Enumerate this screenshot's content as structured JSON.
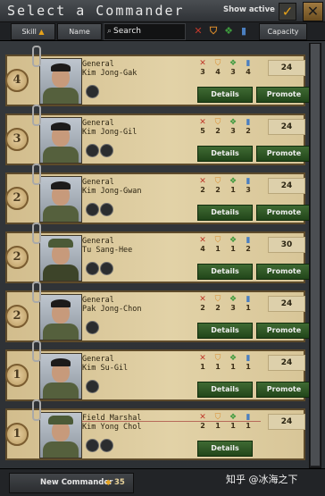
{
  "header": {
    "title": "Select a Commander",
    "show_active_label": "Show active",
    "checkmark": "✓",
    "close_icon_text": "✕"
  },
  "filter_bar": {
    "skill_label": "Skill",
    "name_label": "Name",
    "search_placeholder": "Search",
    "capacity_label": "Capacity"
  },
  "commanders": [
    {
      "level": "4",
      "rank": "General",
      "name": "Kim Jong-Gak",
      "stats": [
        "3",
        "4",
        "3",
        "4"
      ],
      "capacity": "24",
      "details_label": "Details",
      "promote_label": "Promote",
      "traits": [
        "trait-icon"
      ]
    },
    {
      "level": "3",
      "rank": "General",
      "name": "Kim Jong-Gil",
      "stats": [
        "5",
        "2",
        "3",
        "2"
      ],
      "capacity": "24",
      "details_label": "Details",
      "promote_label": "Promote",
      "traits": [
        "trait-icon",
        "trait-icon"
      ]
    },
    {
      "level": "2",
      "rank": "General",
      "name": "Kim Jong-Gwan",
      "stats": [
        "2",
        "2",
        "1",
        "3"
      ],
      "capacity": "24",
      "details_label": "Details",
      "promote_label": "Promote",
      "traits": [
        "trait-icon",
        "trait-icon"
      ]
    },
    {
      "level": "2",
      "rank": "General",
      "name": "Tu Sang-Hee",
      "stats": [
        "4",
        "1",
        "1",
        "2"
      ],
      "capacity": "30",
      "details_label": "Details",
      "promote_label": "Promote",
      "traits": [
        "trait-icon",
        "trait-icon"
      ]
    },
    {
      "level": "2",
      "rank": "General",
      "name": "Pak Jong-Chon",
      "stats": [
        "2",
        "2",
        "3",
        "1"
      ],
      "capacity": "24",
      "details_label": "Details",
      "promote_label": "Promote",
      "traits": [
        "trait-icon"
      ]
    },
    {
      "level": "1",
      "rank": "General",
      "name": "Kim Su-Gil",
      "stats": [
        "1",
        "1",
        "1",
        "1"
      ],
      "capacity": "24",
      "details_label": "Details",
      "promote_label": "Promote",
      "traits": [
        "trait-icon"
      ]
    },
    {
      "level": "1",
      "rank": "Field Marshal",
      "name": "Kim Yong Chol",
      "stats": [
        "2",
        "1",
        "1",
        "1"
      ],
      "capacity": "24",
      "details_label": "Details",
      "promote_label": "",
      "traits": [
        "trait-icon",
        "trait-icon"
      ]
    }
  ],
  "footer": {
    "new_commander_label": "New Commander",
    "new_commander_cost": "35",
    "watermark": "知乎 @冰海之下"
  },
  "colors": {
    "card_bg": "#e2d2a7",
    "button_green": "#2f5a25",
    "attack_icon": "#c0392b",
    "defense_icon": "#d98b2b",
    "planning_icon": "#3e9a3e",
    "logistics_icon": "#4b7fc0"
  }
}
